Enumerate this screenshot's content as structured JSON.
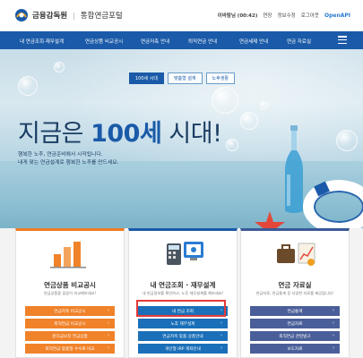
{
  "header": {
    "logo_org": "금융감독원",
    "logo_site": "통합연금포털",
    "util": {
      "user": "이바람님 (00:42)",
      "extend": "연장",
      "myinfo": "정보수정",
      "logout": "로그아웃",
      "api": "OpenAPI"
    }
  },
  "nav": {
    "items": [
      "내 연금조회·재무설계",
      "연금상품 비교공시",
      "연금저축 안내",
      "퇴직연금 안내",
      "연금세제 안내",
      "연금 자료실"
    ]
  },
  "hero": {
    "tabs": [
      {
        "label": "100세 시대",
        "active": true
      },
      {
        "label": "맞춤형 설계",
        "active": false
      },
      {
        "label": "노후생활",
        "active": false
      }
    ],
    "headline_pre": "지금은 ",
    "headline_num": "100세",
    "headline_post": " 시대!",
    "sub1": "행복한 노후, 연금준비에서 시작됩니다.",
    "sub2": "내게 맞는 연금설계로 행복한 노후를 만드세요."
  },
  "cards": [
    {
      "title": "연금상품 비교공시",
      "desc": "연금상품을 꼼꼼히 비교해보세요!",
      "buttons": [
        "연금저축 비교공시",
        "퇴직연금 비교공시",
        "원리금보장 연금상품",
        "퇴직연금 맞춤형 수수료 비교"
      ]
    },
    {
      "title": "내 연금조회 · 재무설계",
      "desc": "내 연금정보를 확인하고, 노후 재무설계를 해보세요!",
      "buttons": [
        "내 연금 조회",
        "노후 재무설계",
        "연금저축 맞춤 상품안내",
        "개인형 IRP 계좌안내"
      ]
    },
    {
      "title": "연금 자료실",
      "desc": "연금자료, 연금통계 등 다양한 자료를 제공합니다!",
      "buttons": [
        "연금통계",
        "연금자료",
        "퇴직연금 관련법규",
        "보도자료"
      ]
    }
  ],
  "arrow": "›",
  "colors": {
    "primary": "#1a5aa8",
    "orange": "#f0822a",
    "highlight": "#e53a3a"
  }
}
